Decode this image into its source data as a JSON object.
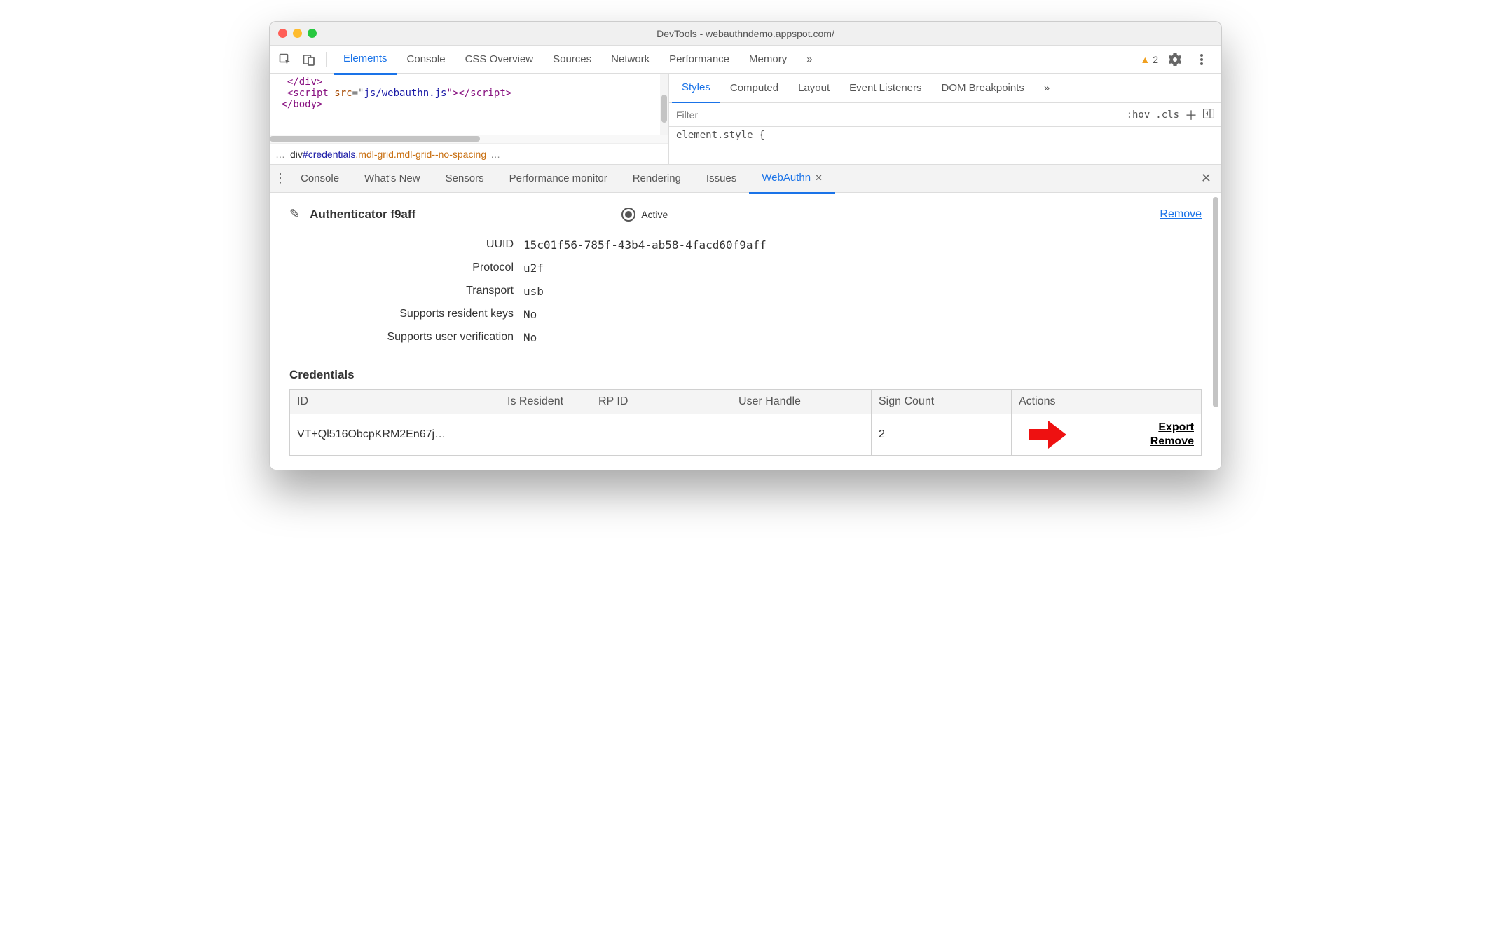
{
  "window": {
    "title": "DevTools - webauthndemo.appspot.com/"
  },
  "mainTabs": [
    "Elements",
    "Console",
    "CSS Overview",
    "Sources",
    "Network",
    "Performance",
    "Memory"
  ],
  "mainTabsActive": "Elements",
  "mainTabsOverflow": "»",
  "warnings": {
    "count": "2"
  },
  "code": {
    "line1a": "</div>",
    "line2_tag_open": "<script ",
    "line2_attr": "src",
    "line2_eq": "=\"",
    "line2_val": "js/webauthn.js",
    "line2_close": "\"></scr",
    "line2_close2": "ipt>",
    "line3": "</body>"
  },
  "breadcrumb": {
    "prefix": "div",
    "id": "#credentials",
    "classes": ".mdl-grid.mdl-grid--no-spacing"
  },
  "stylesTabs": [
    "Styles",
    "Computed",
    "Layout",
    "Event Listeners",
    "DOM Breakpoints"
  ],
  "stylesTabsActive": "Styles",
  "stylesTabsOverflow": "»",
  "filter": {
    "placeholder": "Filter",
    "hov": ":hov",
    "cls": ".cls"
  },
  "styleBody": "element.style {",
  "drawerTabs": [
    "Console",
    "What's New",
    "Sensors",
    "Performance monitor",
    "Rendering",
    "Issues",
    "WebAuthn"
  ],
  "drawerActive": "WebAuthn",
  "authenticator": {
    "title": "Authenticator f9aff",
    "activeLabel": "Active",
    "removeLabel": "Remove",
    "props": {
      "uuid_label": "UUID",
      "uuid": "15c01f56-785f-43b4-ab58-4facd60f9aff",
      "protocol_label": "Protocol",
      "protocol": "u2f",
      "transport_label": "Transport",
      "transport": "usb",
      "resident_label": "Supports resident keys",
      "resident": "No",
      "uv_label": "Supports user verification",
      "uv": "No"
    }
  },
  "credentials": {
    "title": "Credentials",
    "columns": [
      "ID",
      "Is Resident",
      "RP ID",
      "User Handle",
      "Sign Count",
      "Actions"
    ],
    "row": {
      "id": "VT+Ql516ObcpKRM2En67j…",
      "isResident": "",
      "rpId": "",
      "userHandle": "",
      "signCount": "2",
      "exportLabel": "Export",
      "removeLabel": "Remove"
    }
  }
}
